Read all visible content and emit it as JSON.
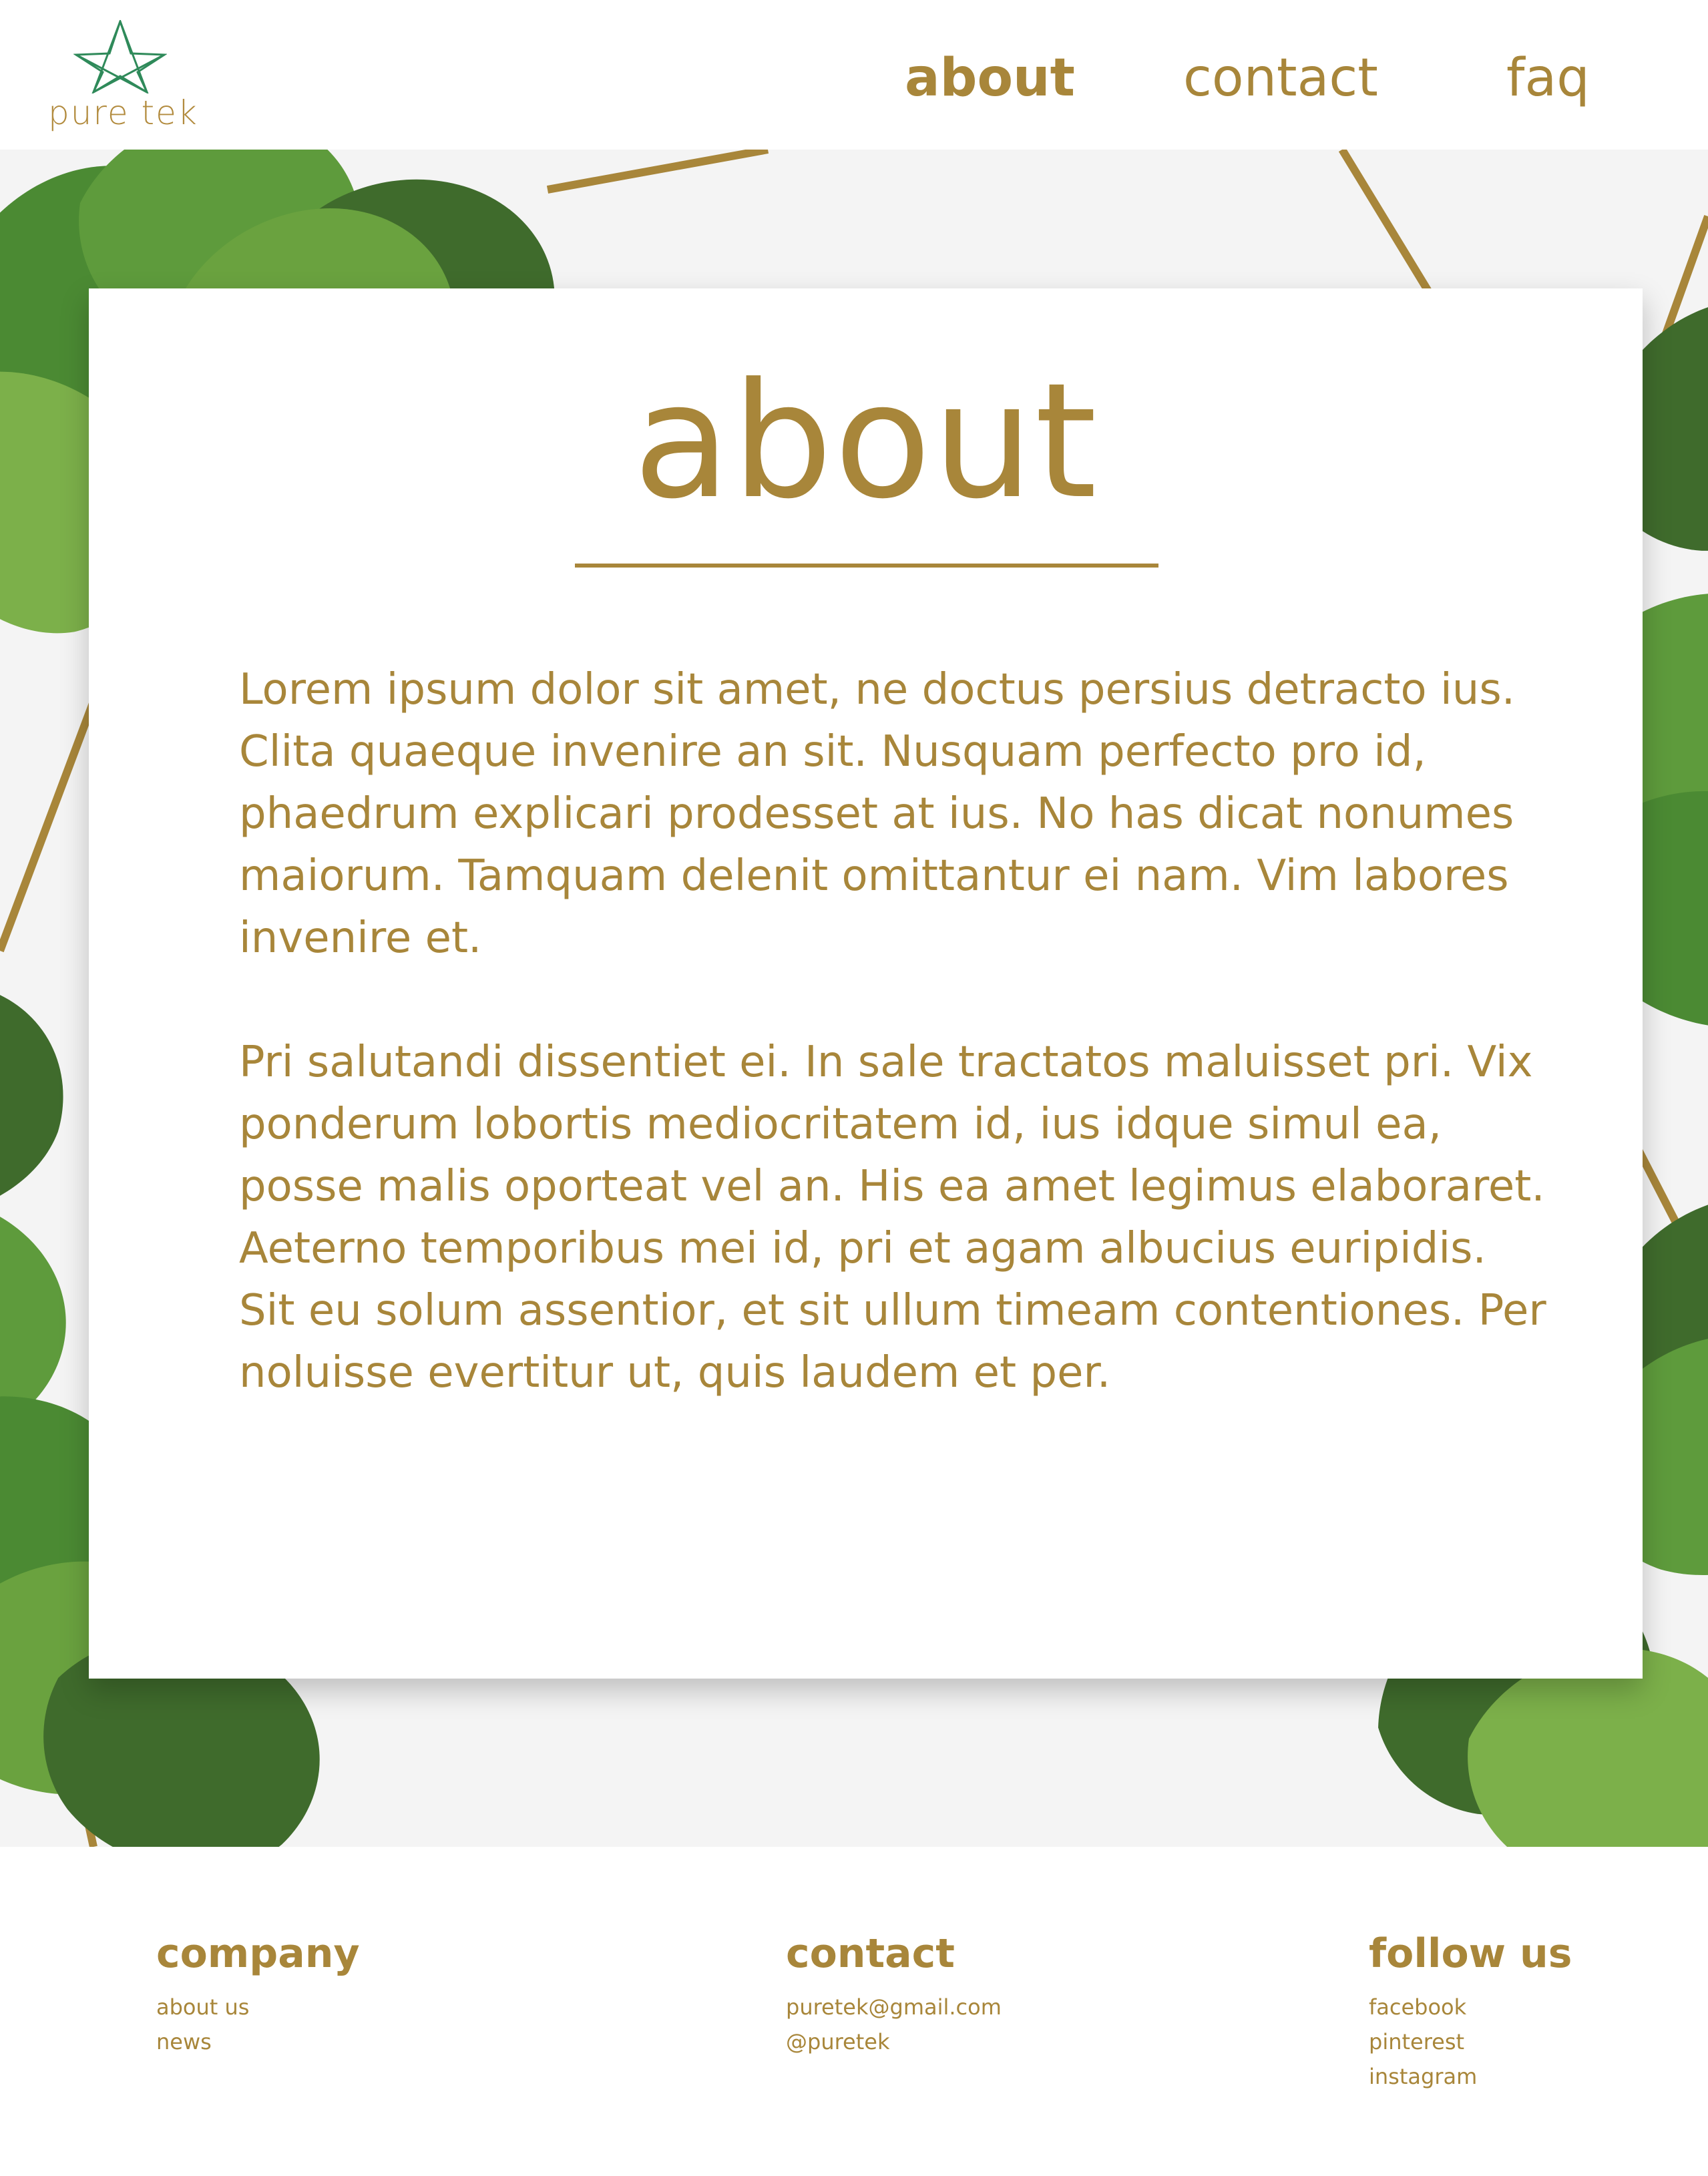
{
  "brand": {
    "logo_text": "pure tek",
    "logo_icon": "star-logo-icon"
  },
  "nav": {
    "about": "about",
    "contact": "contact",
    "faq": "faq"
  },
  "card": {
    "title": "about",
    "paragraphs": [
      "Lorem ipsum dolor sit amet, ne doctus persius detracto ius. Clita quaeque invenire an sit. Nusquam perfecto pro id, phaedrum explicari prodesset at ius. No has dicat nonumes maiorum. Tamquam delenit omittantur ei nam. Vim labores invenire et.",
      "Pri salutandi dissentiet ei. In sale tractatos maluisset pri. Vix ponderum lobortis mediocritatem id, ius idque simul ea, posse malis oporteat vel an. His ea amet legimus elaboraret. Aeterno temporibus mei id, pri et agam albucius euripidis. Sit eu solum assentior, et sit ullum timeam contentiones. Per noluisse evertitur ut, quis laudem et per."
    ]
  },
  "footer": {
    "company": {
      "heading": "company",
      "links": [
        "about us",
        "news"
      ]
    },
    "contact": {
      "heading": "contact",
      "links": [
        "puretek@gmail.com",
        "@puretek"
      ]
    },
    "follow": {
      "heading": "follow us",
      "links": [
        "facebook",
        "pinterest",
        "instagram"
      ]
    }
  },
  "colors": {
    "accent": "#a8863a",
    "leaf_dark": "#3f6b2c",
    "leaf_light": "#7cb04a",
    "background": "#f4f4f4"
  }
}
